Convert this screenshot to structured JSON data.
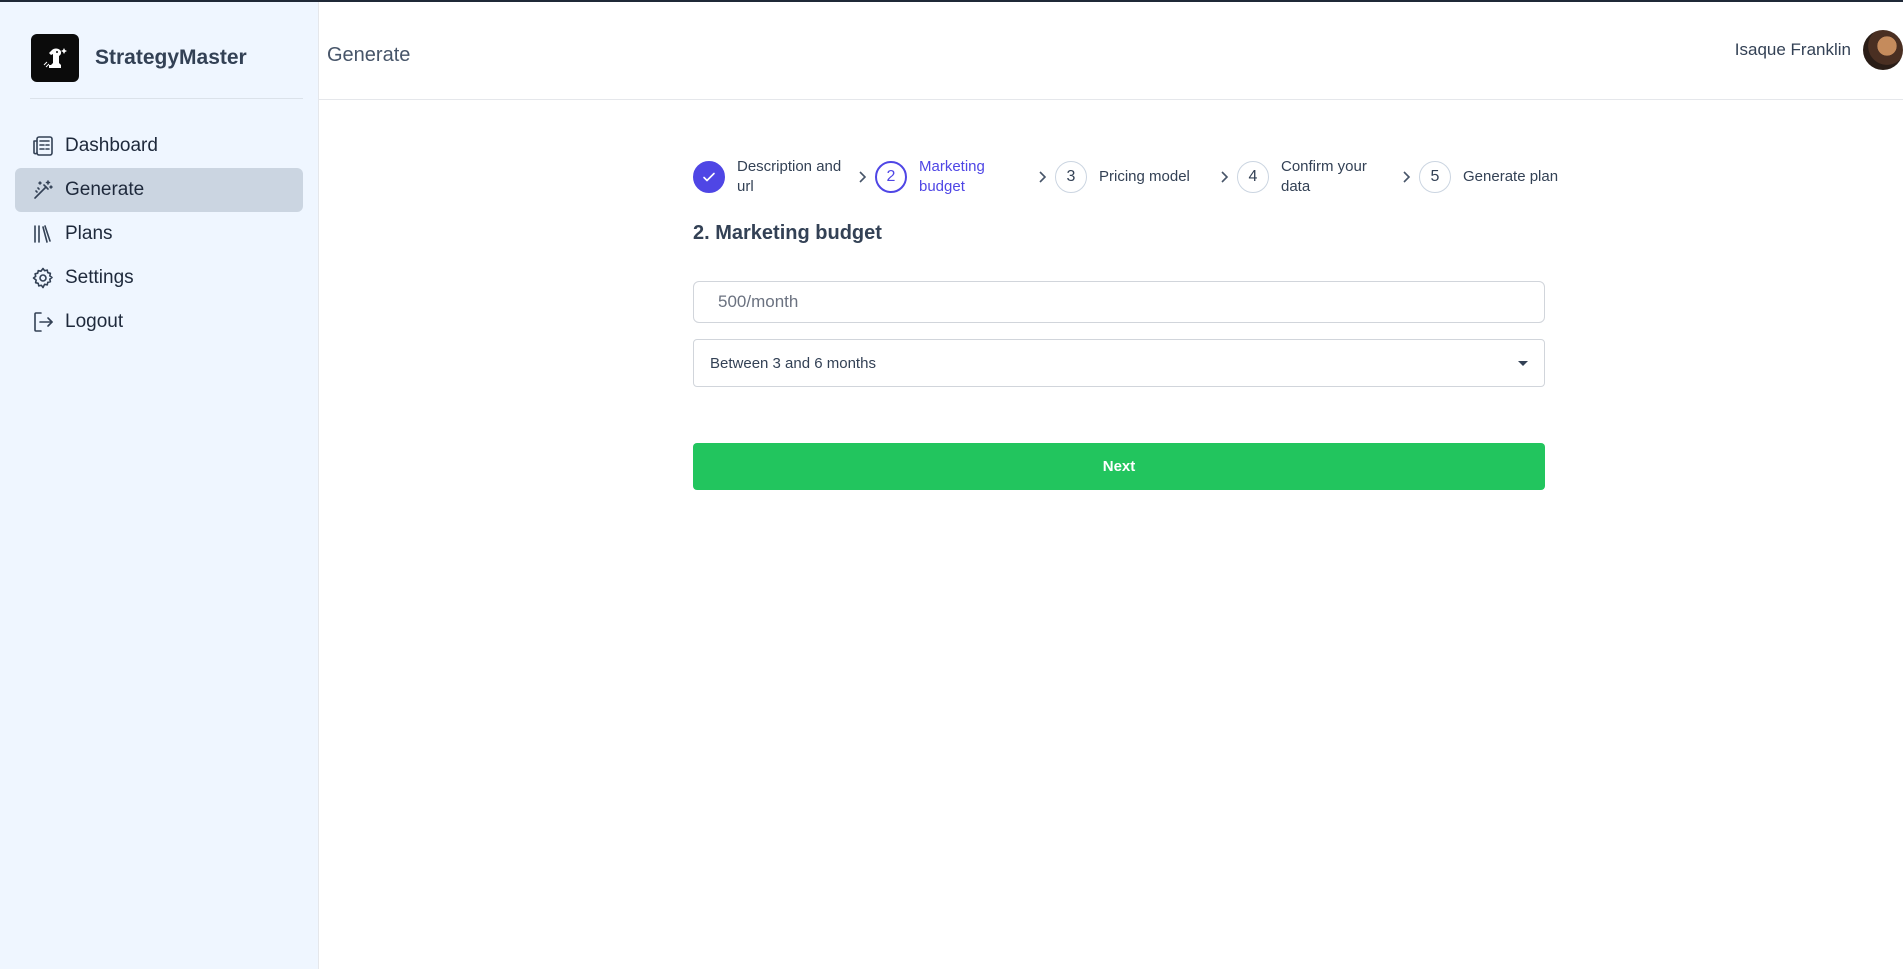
{
  "app": {
    "name": "StrategyMaster"
  },
  "sidebar": {
    "items": [
      {
        "label": "Dashboard",
        "icon": "newspaper-icon"
      },
      {
        "label": "Generate",
        "icon": "magic-wand-icon",
        "active": true
      },
      {
        "label": "Plans",
        "icon": "library-icon"
      },
      {
        "label": "Settings",
        "icon": "gear-icon"
      },
      {
        "label": "Logout",
        "icon": "logout-icon"
      }
    ]
  },
  "header": {
    "title": "Generate",
    "user_name": "Isaque Franklin"
  },
  "stepper": {
    "steps": [
      {
        "number": "1",
        "label": "Description and url",
        "state": "done"
      },
      {
        "number": "2",
        "label": "Marketing budget",
        "state": "current"
      },
      {
        "number": "3",
        "label": "Pricing model",
        "state": "upcoming"
      },
      {
        "number": "4",
        "label": "Confirm your data",
        "state": "upcoming"
      },
      {
        "number": "5",
        "label": "Generate plan",
        "state": "upcoming"
      }
    ]
  },
  "form": {
    "title": "2. Marketing budget",
    "budget_placeholder": "500/month",
    "budget_value": "",
    "duration_value": "Between 3 and 6 months",
    "next_label": "Next"
  },
  "colors": {
    "accent": "#4f46e5",
    "primary_button": "#22c55e",
    "sidebar_bg": "#eff6ff",
    "sidebar_active": "#cbd5e1"
  }
}
